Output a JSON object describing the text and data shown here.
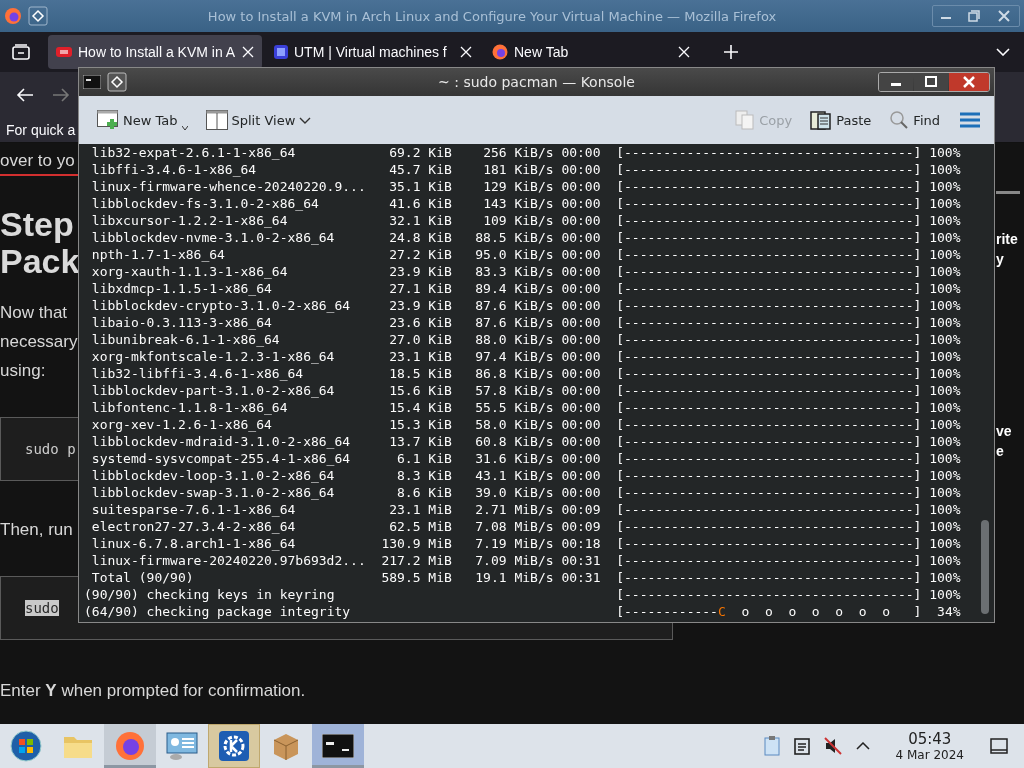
{
  "browser": {
    "title": "How to Install a KVM in Arch Linux and Configure Your Virtual Machine — Mozilla Firefox",
    "tabs": [
      {
        "label": "How to Install a KVM in A",
        "selected": true,
        "kind": "brand"
      },
      {
        "label": "UTM | Virtual machines f",
        "selected": false,
        "kind": "square"
      },
      {
        "label": "New Tab",
        "selected": false,
        "kind": "firefox"
      }
    ],
    "back_disabled": false,
    "forward_disabled": true,
    "notice": "For quick a",
    "page": {
      "lead": "over to yo",
      "heading": [
        "Step",
        "Pack"
      ],
      "paragraph": [
        "Now that",
        "necessary",
        "using:"
      ],
      "code_1": "sudo p",
      "then": "Then, run",
      "code_2": "sudo",
      "enter": "Enter **Y** when prompted for confirmation.",
      "side_1": [
        "rite",
        "y"
      ],
      "side_2": [
        "ve",
        "e"
      ]
    }
  },
  "konsole": {
    "title": "~ : sudo pacman — Konsole",
    "toolbar": [
      {
        "label": "New Tab",
        "kind": "newtab",
        "disabled": false
      },
      {
        "label": "Split View",
        "kind": "split",
        "disabled": false
      },
      {
        "label": "Copy",
        "kind": "copy",
        "disabled": true
      },
      {
        "label": "Paste",
        "kind": "paste",
        "disabled": false
      },
      {
        "label": "Find",
        "kind": "find",
        "disabled": false
      }
    ],
    "rows": [
      {
        "kind": "download",
        "name": "lib32-expat-2.6.1-1-x86_64",
        "size": "69.2 KiB",
        "speed": "256 KiB/s",
        "time": "00:00",
        "bar": "[-------------------------------------]",
        "percent": "100%"
      },
      {
        "kind": "download",
        "name": "libffi-3.4.6-1-x86_64",
        "size": "45.7 KiB",
        "speed": "181 KiB/s",
        "time": "00:00",
        "bar": "[-------------------------------------]",
        "percent": "100%"
      },
      {
        "kind": "download",
        "name": "linux-firmware-whence-20240220.9...",
        "size": "35.1 KiB",
        "speed": "129 KiB/s",
        "time": "00:00",
        "bar": "[-------------------------------------]",
        "percent": "100%"
      },
      {
        "kind": "download",
        "name": "libblockdev-fs-3.1.0-2-x86_64",
        "size": "41.6 KiB",
        "speed": "143 KiB/s",
        "time": "00:00",
        "bar": "[-------------------------------------]",
        "percent": "100%"
      },
      {
        "kind": "download",
        "name": "libxcursor-1.2.2-1-x86_64",
        "size": "32.1 KiB",
        "speed": "109 KiB/s",
        "time": "00:00",
        "bar": "[-------------------------------------]",
        "percent": "100%"
      },
      {
        "kind": "download",
        "name": "libblockdev-nvme-3.1.0-2-x86_64",
        "size": "24.8 KiB",
        "speed": "88.5 KiB/s",
        "time": "00:00",
        "bar": "[-------------------------------------]",
        "percent": "100%"
      },
      {
        "kind": "download",
        "name": "npth-1.7-1-x86_64",
        "size": "27.2 KiB",
        "speed": "95.0 KiB/s",
        "time": "00:00",
        "bar": "[-------------------------------------]",
        "percent": "100%"
      },
      {
        "kind": "download",
        "name": "xorg-xauth-1.1.3-1-x86_64",
        "size": "23.9 KiB",
        "speed": "83.3 KiB/s",
        "time": "00:00",
        "bar": "[-------------------------------------]",
        "percent": "100%"
      },
      {
        "kind": "download",
        "name": "libxdmcp-1.1.5-1-x86_64",
        "size": "27.1 KiB",
        "speed": "89.4 KiB/s",
        "time": "00:00",
        "bar": "[-------------------------------------]",
        "percent": "100%"
      },
      {
        "kind": "download",
        "name": "libblockdev-crypto-3.1.0-2-x86_64",
        "size": "23.9 KiB",
        "speed": "87.6 KiB/s",
        "time": "00:00",
        "bar": "[-------------------------------------]",
        "percent": "100%"
      },
      {
        "kind": "download",
        "name": "libaio-0.3.113-3-x86_64",
        "size": "23.6 KiB",
        "speed": "87.6 KiB/s",
        "time": "00:00",
        "bar": "[-------------------------------------]",
        "percent": "100%"
      },
      {
        "kind": "download",
        "name": "libunibreak-6.1-1-x86_64",
        "size": "27.0 KiB",
        "speed": "88.0 KiB/s",
        "time": "00:00",
        "bar": "[-------------------------------------]",
        "percent": "100%"
      },
      {
        "kind": "download",
        "name": "xorg-mkfontscale-1.2.3-1-x86_64",
        "size": "23.1 KiB",
        "speed": "97.4 KiB/s",
        "time": "00:00",
        "bar": "[-------------------------------------]",
        "percent": "100%"
      },
      {
        "kind": "download",
        "name": "lib32-libffi-3.4.6-1-x86_64",
        "size": "18.5 KiB",
        "speed": "86.8 KiB/s",
        "time": "00:00",
        "bar": "[-------------------------------------]",
        "percent": "100%"
      },
      {
        "kind": "download",
        "name": "libblockdev-part-3.1.0-2-x86_64",
        "size": "15.6 KiB",
        "speed": "57.8 KiB/s",
        "time": "00:00",
        "bar": "[-------------------------------------]",
        "percent": "100%"
      },
      {
        "kind": "download",
        "name": "libfontenc-1.1.8-1-x86_64",
        "size": "15.4 KiB",
        "speed": "55.5 KiB/s",
        "time": "00:00",
        "bar": "[-------------------------------------]",
        "percent": "100%"
      },
      {
        "kind": "download",
        "name": "xorg-xev-1.2.6-1-x86_64",
        "size": "15.3 KiB",
        "speed": "58.0 KiB/s",
        "time": "00:00",
        "bar": "[-------------------------------------]",
        "percent": "100%"
      },
      {
        "kind": "download",
        "name": "libblockdev-mdraid-3.1.0-2-x86_64",
        "size": "13.7 KiB",
        "speed": "60.8 KiB/s",
        "time": "00:00",
        "bar": "[-------------------------------------]",
        "percent": "100%"
      },
      {
        "kind": "download",
        "name": "systemd-sysvcompat-255.4-1-x86_64",
        "size": "6.1 KiB",
        "speed": "31.6 KiB/s",
        "time": "00:00",
        "bar": "[-------------------------------------]",
        "percent": "100%"
      },
      {
        "kind": "download",
        "name": "libblockdev-loop-3.1.0-2-x86_64",
        "size": "8.3 KiB",
        "speed": "43.1 KiB/s",
        "time": "00:00",
        "bar": "[-------------------------------------]",
        "percent": "100%"
      },
      {
        "kind": "download",
        "name": "libblockdev-swap-3.1.0-2-x86_64",
        "size": "8.6 KiB",
        "speed": "39.0 KiB/s",
        "time": "00:00",
        "bar": "[-------------------------------------]",
        "percent": "100%"
      },
      {
        "kind": "download",
        "name": "suitesparse-7.6.1-1-x86_64",
        "size": "23.1 MiB",
        "speed": "2.71 MiB/s",
        "time": "00:09",
        "bar": "[-------------------------------------]",
        "percent": "100%"
      },
      {
        "kind": "download",
        "name": "electron27-27.3.4-2-x86_64",
        "size": "62.5 MiB",
        "speed": "7.08 MiB/s",
        "time": "00:09",
        "bar": "[-------------------------------------]",
        "percent": "100%"
      },
      {
        "kind": "download",
        "name": "linux-6.7.8.arch1-1-x86_64",
        "size": "130.9 MiB",
        "speed": "7.19 MiB/s",
        "time": "00:18",
        "bar": "[-------------------------------------]",
        "percent": "100%"
      },
      {
        "kind": "download",
        "name": "linux-firmware-20240220.97b693d2...",
        "size": "217.2 MiB",
        "speed": "7.09 MiB/s",
        "time": "00:31",
        "bar": "[-------------------------------------]",
        "percent": "100%"
      },
      {
        "kind": "download",
        "name": "Total (90/90)",
        "size": "589.5 MiB",
        "speed": "19.1 MiB/s",
        "time": "00:31",
        "bar": "[-------------------------------------]",
        "percent": "100%"
      },
      {
        "kind": "step",
        "name": "(90/90) checking keys in keyring",
        "bar": "[-------------------------------------]",
        "percent": "100%"
      },
      {
        "kind": "step",
        "name": "(64/90) checking package integrity",
        "bar": "[------------",
        "pacman": "C",
        "bar_rest": "  o  o  o  o  o  o  o   ]",
        "percent": "34%"
      }
    ]
  },
  "taskbar": {
    "apps": [
      {
        "kind": "start",
        "running": false,
        "hovered": false,
        "selected": false
      },
      {
        "kind": "folder",
        "running": false,
        "hovered": false,
        "selected": false
      },
      {
        "kind": "firefox",
        "running": true,
        "hovered": false,
        "selected": false
      },
      {
        "kind": "system",
        "running": false,
        "hovered": false,
        "selected": false
      },
      {
        "kind": "kde",
        "running": false,
        "hovered": true,
        "selected": false
      },
      {
        "kind": "package",
        "running": false,
        "hovered": false,
        "selected": false
      },
      {
        "kind": "terminal",
        "running": true,
        "hovered": false,
        "selected": true
      }
    ],
    "time": "05:43",
    "date": "4 Mar 2024"
  }
}
